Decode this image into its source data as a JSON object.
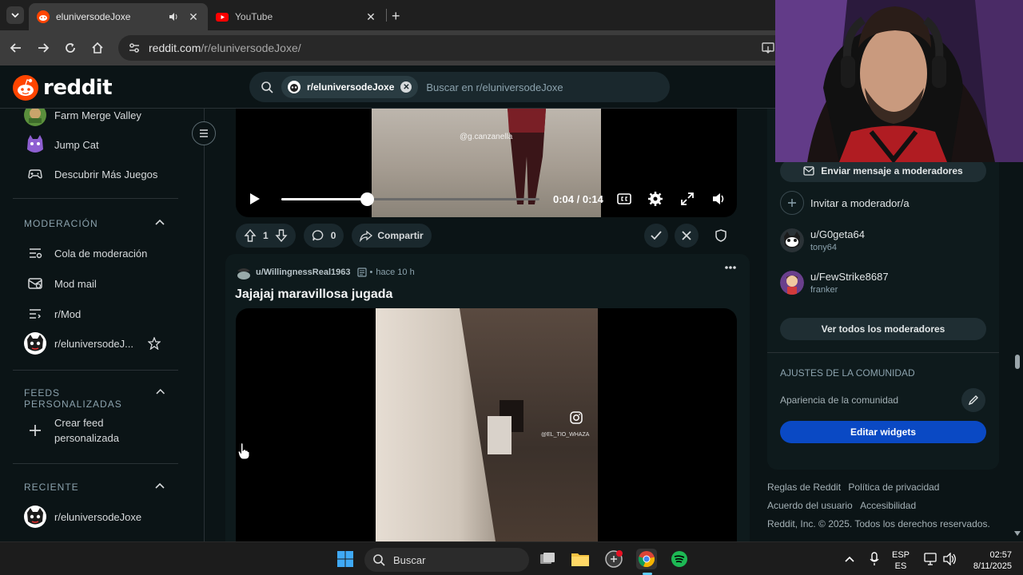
{
  "browser": {
    "tabs": [
      {
        "title": "eluniversodeJoxe",
        "active": true
      },
      {
        "title": "YouTube",
        "active": false
      }
    ],
    "url_host": "reddit.com",
    "url_path": "/r/eluniversodeJoxe/"
  },
  "reddit": {
    "logo_text": "reddit",
    "search": {
      "chip": "r/eluniversodeJoxe",
      "placeholder": "Buscar en r/eluniversodeJoxe"
    }
  },
  "sidebar": {
    "games": [
      {
        "label": "Farm Merge Valley"
      },
      {
        "label": "Jump Cat"
      },
      {
        "label": "Descubrir Más Juegos"
      }
    ],
    "moderation": {
      "heading": "MODERACIÓN",
      "items": [
        {
          "label": "Cola de moderación"
        },
        {
          "label": "Mod mail"
        },
        {
          "label": "r/Mod"
        },
        {
          "label": "r/eluniversodeJ..."
        }
      ]
    },
    "custom_feeds": {
      "heading": "FEEDS PERSONALIZADAS",
      "create_line1": "Crear feed",
      "create_line2": "personalizada"
    },
    "recent": {
      "heading": "RECIENTE",
      "items": [
        {
          "label": "r/eluniversodeJoxe"
        }
      ]
    }
  },
  "feed": {
    "video1": {
      "watermark": "@g.canzanella",
      "time": "0:04 / 0:14",
      "progress": 0.33
    },
    "post1_actions": {
      "votes": "1",
      "comments": "0",
      "share": "Compartir"
    },
    "post2": {
      "user": "u/WillingnessReal1963",
      "time": "hace 10 h",
      "title": "Jajajaj maravillosa jugada",
      "watermark": "@EL_TIO_WHAZA"
    }
  },
  "right_panel": {
    "message_mods": "Enviar mensaje a moderadores",
    "invite_mod": "Invitar a moderador/a",
    "mods": [
      {
        "name": "u/G0geta64",
        "flair": "tony64"
      },
      {
        "name": "u/FewStrike8687",
        "flair": "franker"
      }
    ],
    "view_all_mods": "Ver todos los moderadores",
    "community_settings": {
      "heading": "AJUSTES DE LA COMUNIDAD",
      "appearance": "Apariencia de la comunidad",
      "edit_widgets": "Editar widgets"
    },
    "footer": {
      "rules": "Reglas de Reddit",
      "privacy": "Política de privacidad",
      "agreement": "Acuerdo del usuario",
      "accessibility": "Accesibilidad",
      "copyright": "Reddit, Inc. © 2025. Todos los derechos reservados."
    }
  },
  "taskbar": {
    "search": "Buscar",
    "lang1": "ESP",
    "lang2": "ES",
    "time": "02:57",
    "date": "8/11/2025"
  },
  "colors": {
    "reddit_orange": "#ff4500",
    "edit_widgets_blue": "#0a49c4",
    "background": "#0b1416"
  }
}
